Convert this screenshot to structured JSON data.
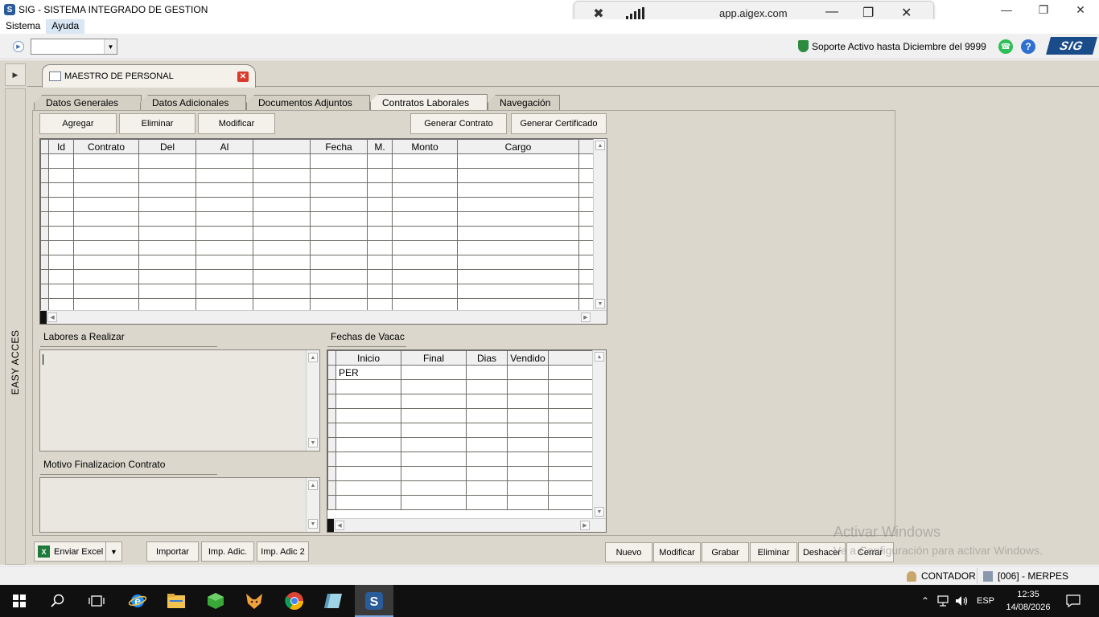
{
  "window": {
    "title": "SIG - SISTEMA INTEGRADO DE GESTION",
    "controls": [
      "minimize-icon",
      "restore-icon",
      "close-icon"
    ]
  },
  "remote_bar": {
    "host": "app.aigex.com"
  },
  "menu": {
    "items": [
      "Sistema",
      "Ayuda"
    ]
  },
  "toolbar": {
    "combo_value": "",
    "support_text": "Soporte Activo hasta Diciembre del 9999",
    "logo_text": "SIG"
  },
  "sidebar": {
    "label": "EASY ACCES"
  },
  "document_tab": {
    "label": "MAESTRO DE PERSONAL"
  },
  "tabs": [
    {
      "label": "Datos Generales",
      "active": false
    },
    {
      "label": "Datos Adicionales",
      "active": false
    },
    {
      "label": "Documentos Adjuntos",
      "active": false
    },
    {
      "label": "Contratos Laborales",
      "active": true
    },
    {
      "label": "Navegación",
      "active": false
    }
  ],
  "contract_buttons": {
    "add": "Agregar",
    "delete": "Eliminar",
    "modify": "Modificar",
    "generate_contract": "Generar Contrato",
    "generate_certificate": "Generar Certificado"
  },
  "contracts_grid": {
    "columns": [
      "Id",
      "Contrato",
      "Del",
      "Al",
      "",
      "Fecha",
      "M.",
      "Monto",
      "Cargo",
      ""
    ],
    "rows": []
  },
  "labores": {
    "label": "Labores a Realizar",
    "value": ""
  },
  "motivo": {
    "label": "Motivo Finalizacion Contrato",
    "value": ""
  },
  "vacaciones": {
    "label": "Fechas de Vacac",
    "columns": [
      "Inicio",
      "Final",
      "Dias",
      "Vendido",
      ""
    ],
    "rows": [
      [
        "PER",
        "",
        "",
        "",
        ""
      ]
    ]
  },
  "bottom_buttons": {
    "excel": "Enviar Excel",
    "import": "Importar",
    "imp_adic": "Imp. Adic.",
    "imp_adic2": "Imp. Adic 2",
    "nuevo": "Nuevo",
    "modificar": "Modificar",
    "grabar": "Grabar",
    "eliminar": "Eliminar",
    "deshacer": "Deshacer",
    "cerrar": "Cerrar"
  },
  "watermark": {
    "line1": "Activar Windows",
    "line2": "Ve a Configuración para activar Windows."
  },
  "status": {
    "user": "CONTADOR",
    "company": "[006] - MERPES"
  },
  "taskbar": {
    "lang": "ESP",
    "time": "12:35",
    "date": "14/08/2026"
  }
}
